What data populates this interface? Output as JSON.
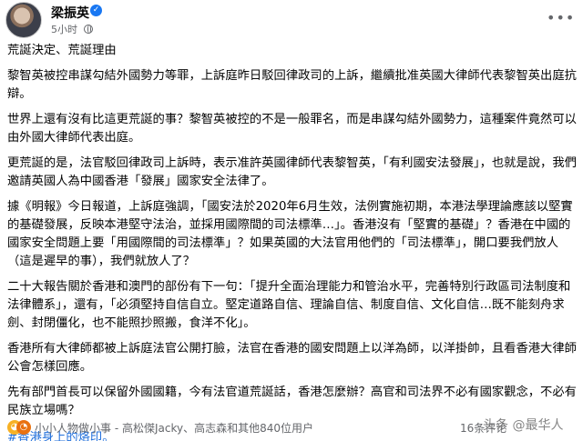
{
  "post": {
    "author": "梁振英",
    "verified_mark": "✓",
    "time": "5小时",
    "more_label": "•••",
    "paragraphs": [
      "荒誕決定、荒誕理由",
      "黎智英被控串謀勾結外國勢力等罪，上訴庭昨日駁回律政司的上訴，繼續批准英國大律師代表黎智英出庭抗辯。",
      "世界上還有沒有比這更荒誕的事？黎智英被控的不是一般罪名，而是串謀勾結外國勢力，這種案件竟然可以由外國大律師代表出庭。",
      "更荒誕的是，法官駁回律政司上訴時，表示准許英國律師代表黎智英，「有利國安法發展」，也就是說，我們邀請英國人為中國香港「發展」國家安全法律了。",
      "據《明報》今日報道，上訴庭強調，「國安法於2020年6月生效，法例實施初期，本港法學理論應該以堅實的基礎發展，反映本港堅守法治，並採用國際間的司法標準…」。香港沒有「堅實的基礎」？香港在中國的國家安全問題上要「用國際間的司法標準」？如果英國的大法官用他們的「司法標準」，開口要我們放人（這是遲早的事），我們就放人了？",
      "二十大報告關於香港和澳門的部份有下一句：「提升全面治理能力和管治水平，完善特別行政區司法制度和法律體系」，還有，「必須堅持自信自立。堅定道路自信、理論自信、制度自信、文化自信…既不能刻舟求劍、封閉僵化，也不能照抄照搬，食洋不化」。",
      "香港所有大律師都被上訴庭法官公開打臉，法官在香港的國安問題上以洋為師，以洋掛帥，且看香港大律師公會怎樣回應。",
      "先有部門首長可以保留外國國籍，今有法官道荒誕話，香港怎麼辦？高官和司法界不必有國家觀念，不必有民族立場嗎？"
    ],
    "hashtag": "#香港身上的烙印。"
  },
  "footer": {
    "reactions": [
      "sad",
      "angry"
    ],
    "reaction_summary": "小小人物做小事 - 高松傑Jacky、高志森和其他840位用户",
    "comments": "16条评论",
    "watermark": "头条 @最华人"
  }
}
